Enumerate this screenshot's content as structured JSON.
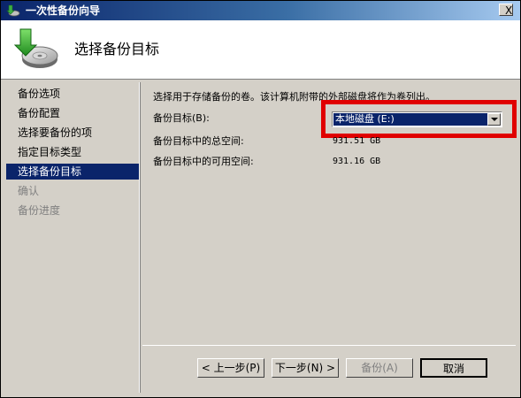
{
  "window": {
    "title": "一次性备份向导",
    "close_label": "X"
  },
  "header": {
    "title": "选择备份目标"
  },
  "sidebar": {
    "items": [
      {
        "label": "备份选项"
      },
      {
        "label": "备份配置"
      },
      {
        "label": "选择要备份的项"
      },
      {
        "label": "指定目标类型"
      },
      {
        "label": "选择备份目标"
      },
      {
        "label": "确认"
      },
      {
        "label": "备份进度"
      }
    ]
  },
  "main": {
    "intro": "选择用于存储备份的卷。该计算机附带的外部磁盘将作为卷列出。",
    "target_label": "备份目标(B):",
    "target_value": "本地磁盘 (E:)",
    "total_label": "备份目标中的总空间:",
    "total_value": "931.51 GB",
    "free_label": "备份目标中的可用空间:",
    "free_value": "931.16 GB"
  },
  "buttons": {
    "prev": "< 上一步(P)",
    "next": "下一步(N) >",
    "backup": "备份(A)",
    "cancel": "取消"
  },
  "colors": {
    "title_bar": "#0a246a",
    "selection": "#0a246a",
    "highlight_box": "#e00000"
  }
}
